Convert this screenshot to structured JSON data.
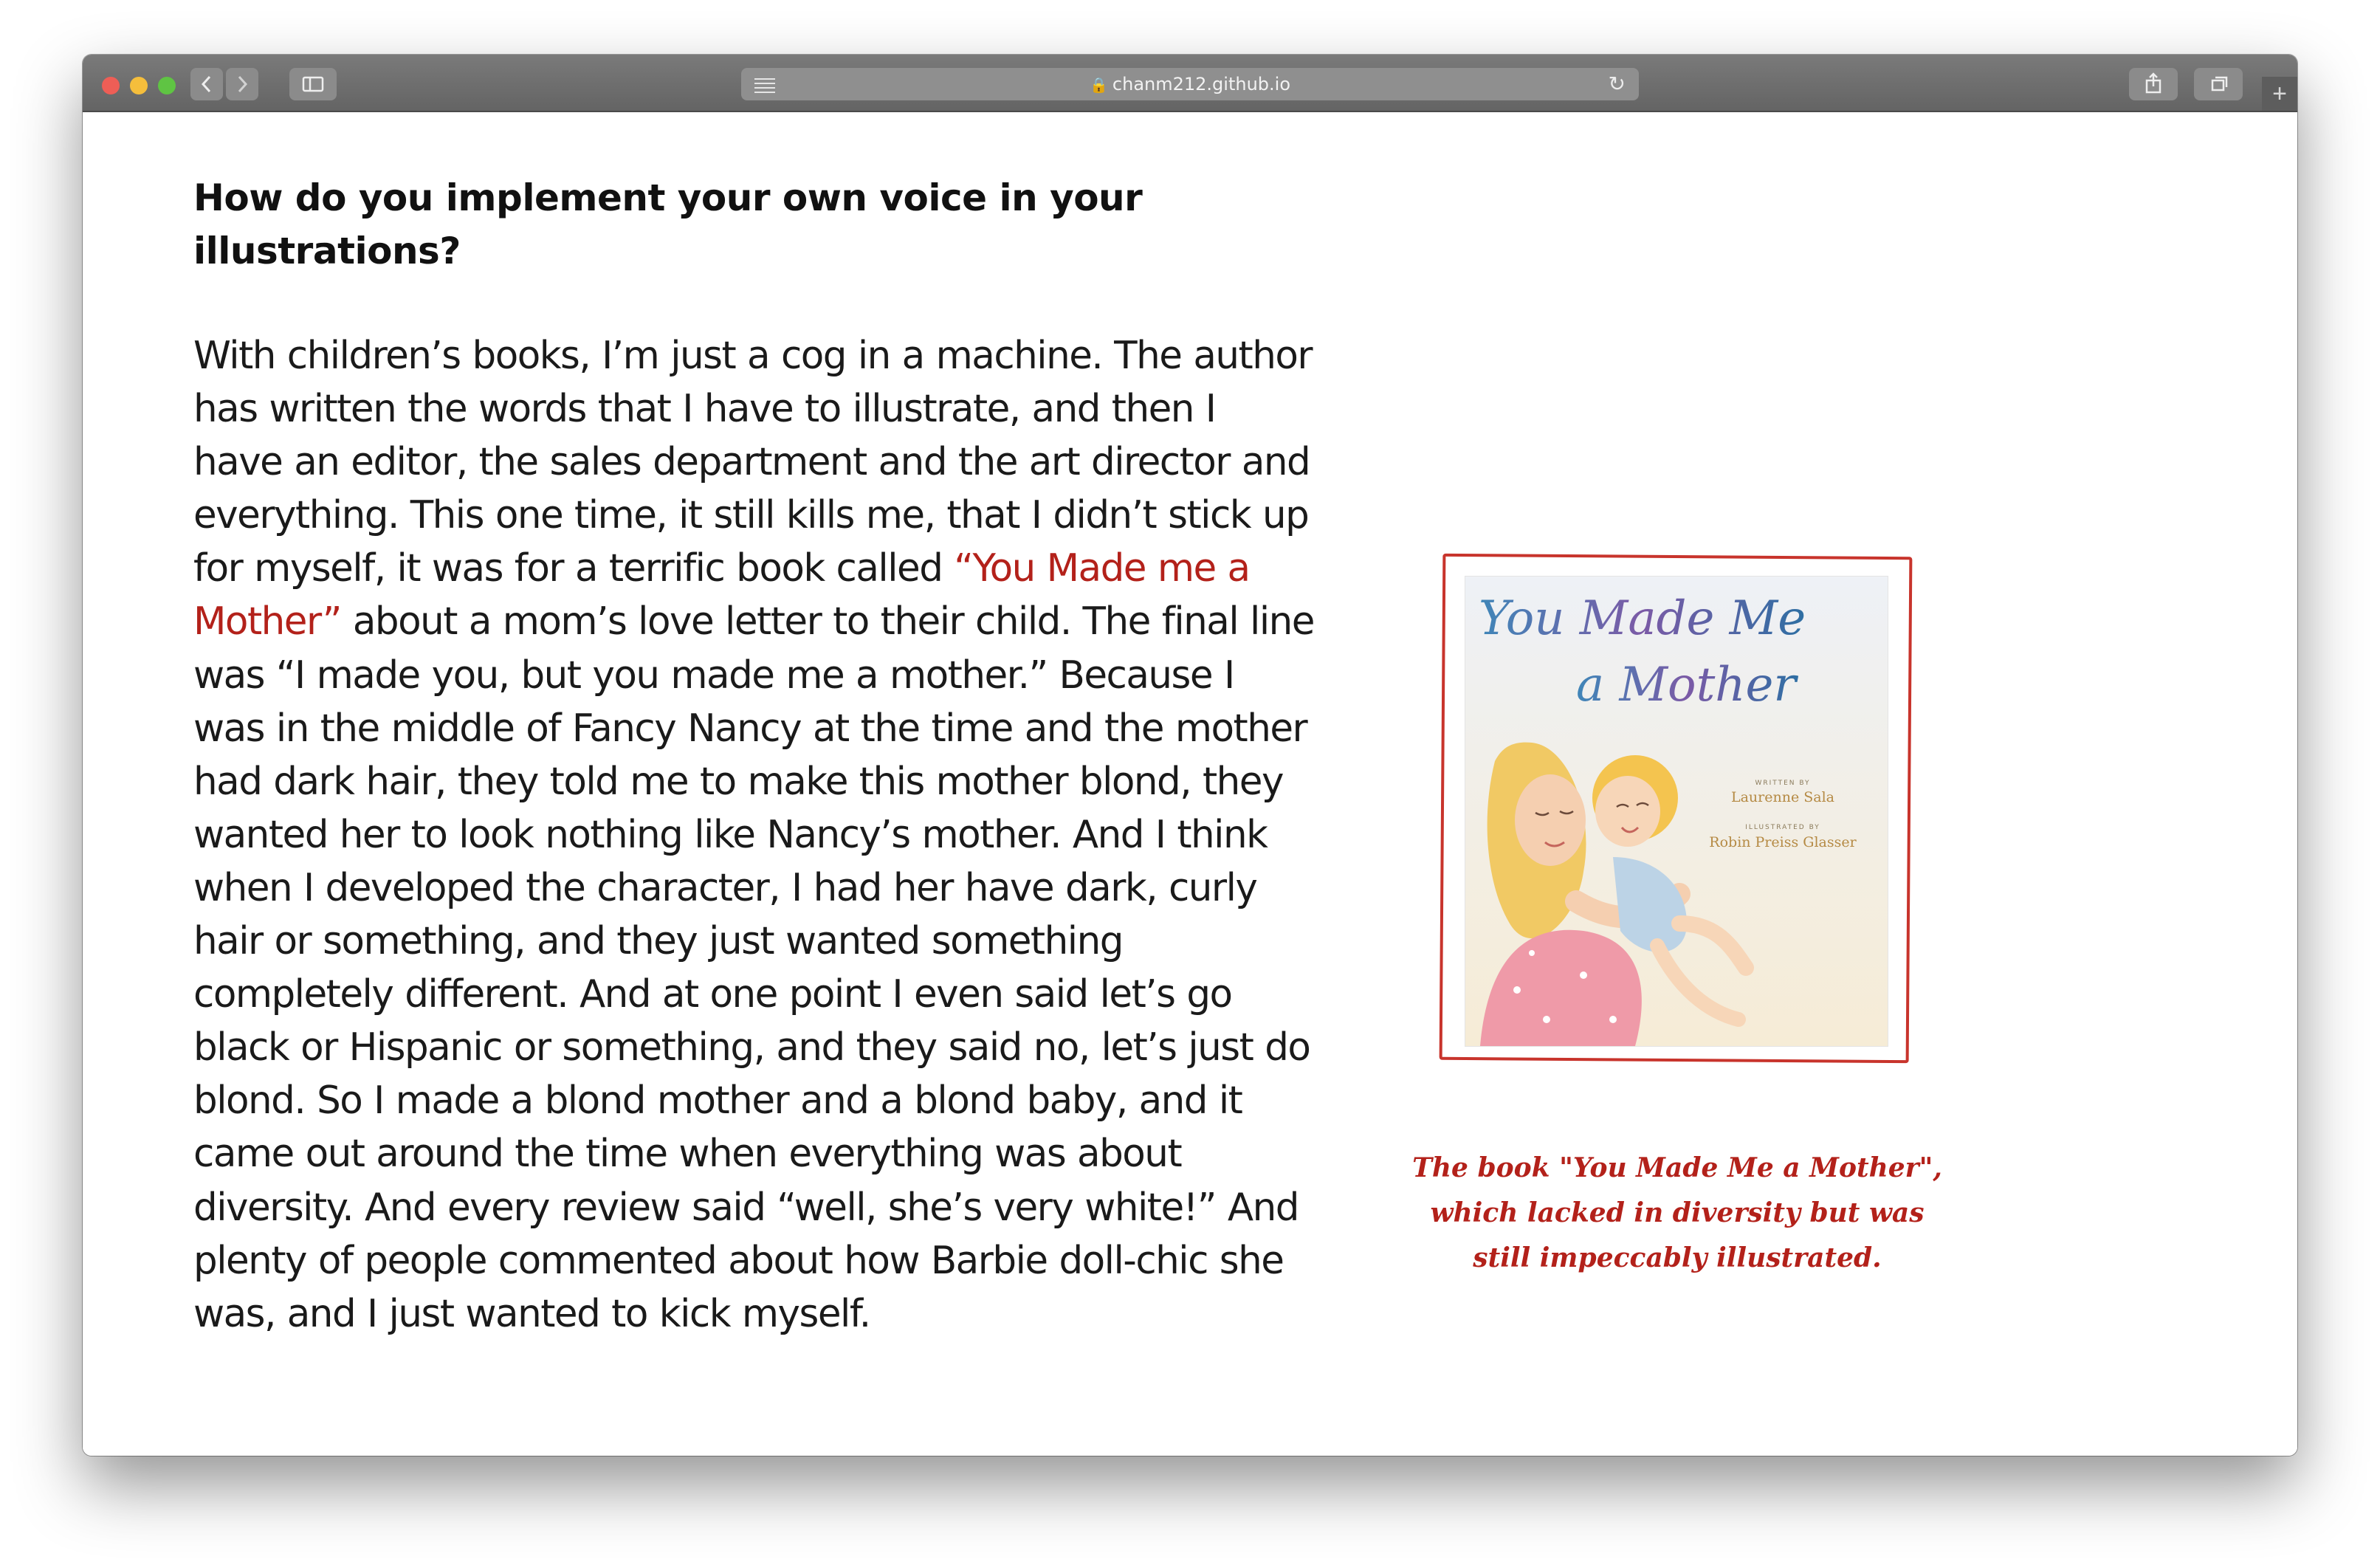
{
  "browser": {
    "url": "chanm212.github.io",
    "back_icon": "chevron-left-icon",
    "forward_icon": "chevron-right-icon",
    "sidebar_icon": "sidebar-icon",
    "reader_icon": "reader-mode-icon",
    "lock_icon": "lock-icon",
    "reload_icon": "reload-icon",
    "share_icon": "share-icon",
    "tabs_icon": "tabs-overview-icon",
    "newtab_label": "+"
  },
  "article": {
    "heading_line1": "How do you implement your own voice in your",
    "heading_line2": "illustrations?",
    "para_before_link": "With children’s books, I’m just a cog in a machine. The author has written the words that I have to illustrate, and then I have an editor, the sales department and the art director and everything. This one time, it still kills me, that I didn’t stick up for myself, it was for a terrific book called ",
    "link_text": "“You Made me a Mother”",
    "para_after_link": " about a mom’s love letter to their child. The final line was “I made you, but you made me a mother.” Because I was in the middle of Fancy Nancy at the time and the mother had dark hair, they told me to make this mother blond, they wanted her to look nothing like Nancy’s mother. And I think when I developed the character, I had her have dark, curly hair or something, and they just wanted something completely different. And at one point I even said let’s go black or Hispanic or something, and they said no, let’s just do blond. So I made a blond mother and a blond baby, and it came out around the time when everything was about diversity. And every review said “well, she’s very white!” And plenty of people commented about how Barbie doll-chic she was, and I just wanted to kick myself."
  },
  "figure": {
    "cover_title_line1": "You Made Me",
    "cover_title_line2": "a Mother",
    "written_by": "WRITTEN BY",
    "author": "Laurenne Sala",
    "illustrated_by": "ILLUSTRATED BY",
    "illustrator": "Robin Preiss Glasser",
    "caption": "The book \"You Made Me a Mother\", which lacked in diversity but was still impeccably illustrated."
  },
  "colors": {
    "accent_red": "#b3211a",
    "frame_red": "#c8342c",
    "text": "#1a1a1a",
    "chrome": "#6e6e6e"
  }
}
